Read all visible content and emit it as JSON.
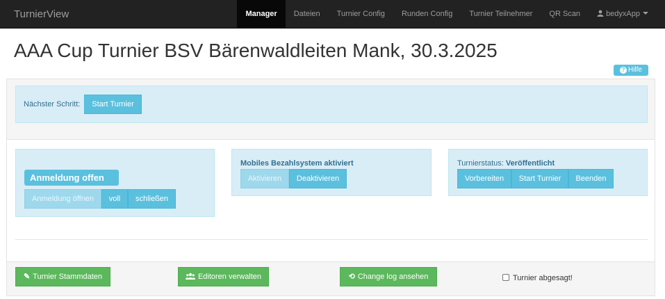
{
  "navbar": {
    "brand": "TurnierView",
    "items": [
      {
        "label": "Manager"
      },
      {
        "label": "Dateien"
      },
      {
        "label": "Turnier Config"
      },
      {
        "label": "Runden Config"
      },
      {
        "label": "Turnier Teilnehmer"
      },
      {
        "label": "QR Scan"
      }
    ],
    "user": "bedyxApp"
  },
  "page": {
    "title": "AAA Cup Turnier BSV Bärenwaldleiten Mank, 30.3.2025",
    "help_label": "Hilfe"
  },
  "next_step": {
    "label": "Nächster Schritt:",
    "button": "Start Turnier"
  },
  "registration": {
    "status": "Anmeldung offen",
    "buttons": [
      "Anmeldung öffnen",
      "voll",
      "schließen"
    ]
  },
  "payment": {
    "heading": "Mobiles Bezahlsystem aktiviert",
    "buttons": [
      "Aktivieren",
      "Deaktivieren"
    ]
  },
  "tournament_status": {
    "prefix": "Turnierstatus:",
    "value": "Veröffentlicht",
    "buttons": [
      "Vorbereiten",
      "Start Turnier",
      "Beenden"
    ]
  },
  "footer": {
    "buttons": [
      "Turnier Stammdaten",
      "Editoren verwalten",
      "Change log ansehen"
    ],
    "cancelled_label": "Turnier abgesagt!"
  },
  "colors": {
    "navbar": "#222222",
    "info": "#5bc0de",
    "info_bg": "#d9edf7",
    "success": "#5cb85c"
  }
}
